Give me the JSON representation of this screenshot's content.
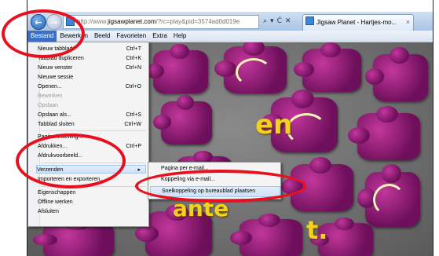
{
  "browser": {
    "url_proto": "http://www.",
    "url_domain": "jigsawplanet.com",
    "url_rest": "/?rc=play&pid=3574ad0d019e",
    "addr_search_icon": "search-icon",
    "addr_tools_text": [
      "▾",
      "Ċ",
      "✕"
    ],
    "tab_title": "Jigsaw Planet - Hartjes-mo...",
    "tab_close": "×"
  },
  "menubar": {
    "items": [
      "Bestand",
      "Bewerken",
      "Beeld",
      "Favorieten",
      "Extra",
      "Help"
    ],
    "active": "Bestand"
  },
  "file_menu": {
    "items": [
      {
        "label": "Nieuw tabblad",
        "shortcut": "Ctrl+T"
      },
      {
        "label": "Tabblad dupliceren",
        "shortcut": "Ctrl+K"
      },
      {
        "label": "Nieuw venster",
        "shortcut": "Ctrl+N"
      },
      {
        "label": "Nieuwe sessie",
        "shortcut": ""
      },
      {
        "label": "Openen...",
        "shortcut": "Ctrl+O"
      },
      {
        "label": "Bewerken",
        "shortcut": "",
        "disabled": true
      },
      {
        "label": "Opslaan",
        "shortcut": "",
        "disabled": true
      },
      {
        "label": "Opslaan als...",
        "shortcut": "Ctrl+S"
      },
      {
        "label": "Tabblad sluiten",
        "shortcut": "Ctrl+W"
      },
      {
        "label": "Pagina-instelling...",
        "shortcut": ""
      },
      {
        "label": "Afdrukken...",
        "shortcut": "Ctrl+P"
      },
      {
        "label": "Afdrukvoorbeeld...",
        "shortcut": ""
      },
      {
        "label": "Verzenden",
        "shortcut": "",
        "submenu": true
      },
      {
        "label": "Importeren en exporteren...",
        "shortcut": ""
      },
      {
        "label": "Eigenschappen",
        "shortcut": ""
      },
      {
        "label": "Offline werken",
        "shortcut": ""
      },
      {
        "label": "Afsluiten",
        "shortcut": ""
      }
    ],
    "submenu_arrow": "▸"
  },
  "send_submenu": {
    "items": [
      {
        "label": "Pagina per e-mail..."
      },
      {
        "label": "Koppeling via e-mail..."
      },
      {
        "label": "Snelkoppeling op bureaublad plaatsen"
      }
    ]
  },
  "puzzle_text": {
    "fragment_1": "en",
    "fragment_2": "ante",
    "fragment_3": "t."
  },
  "colors": {
    "annotation_red": "#e8101e",
    "puzzle_purple": "#8e1a75",
    "text_yellow": "#f2d21e",
    "menu_highlight": "#3a6fc4"
  }
}
